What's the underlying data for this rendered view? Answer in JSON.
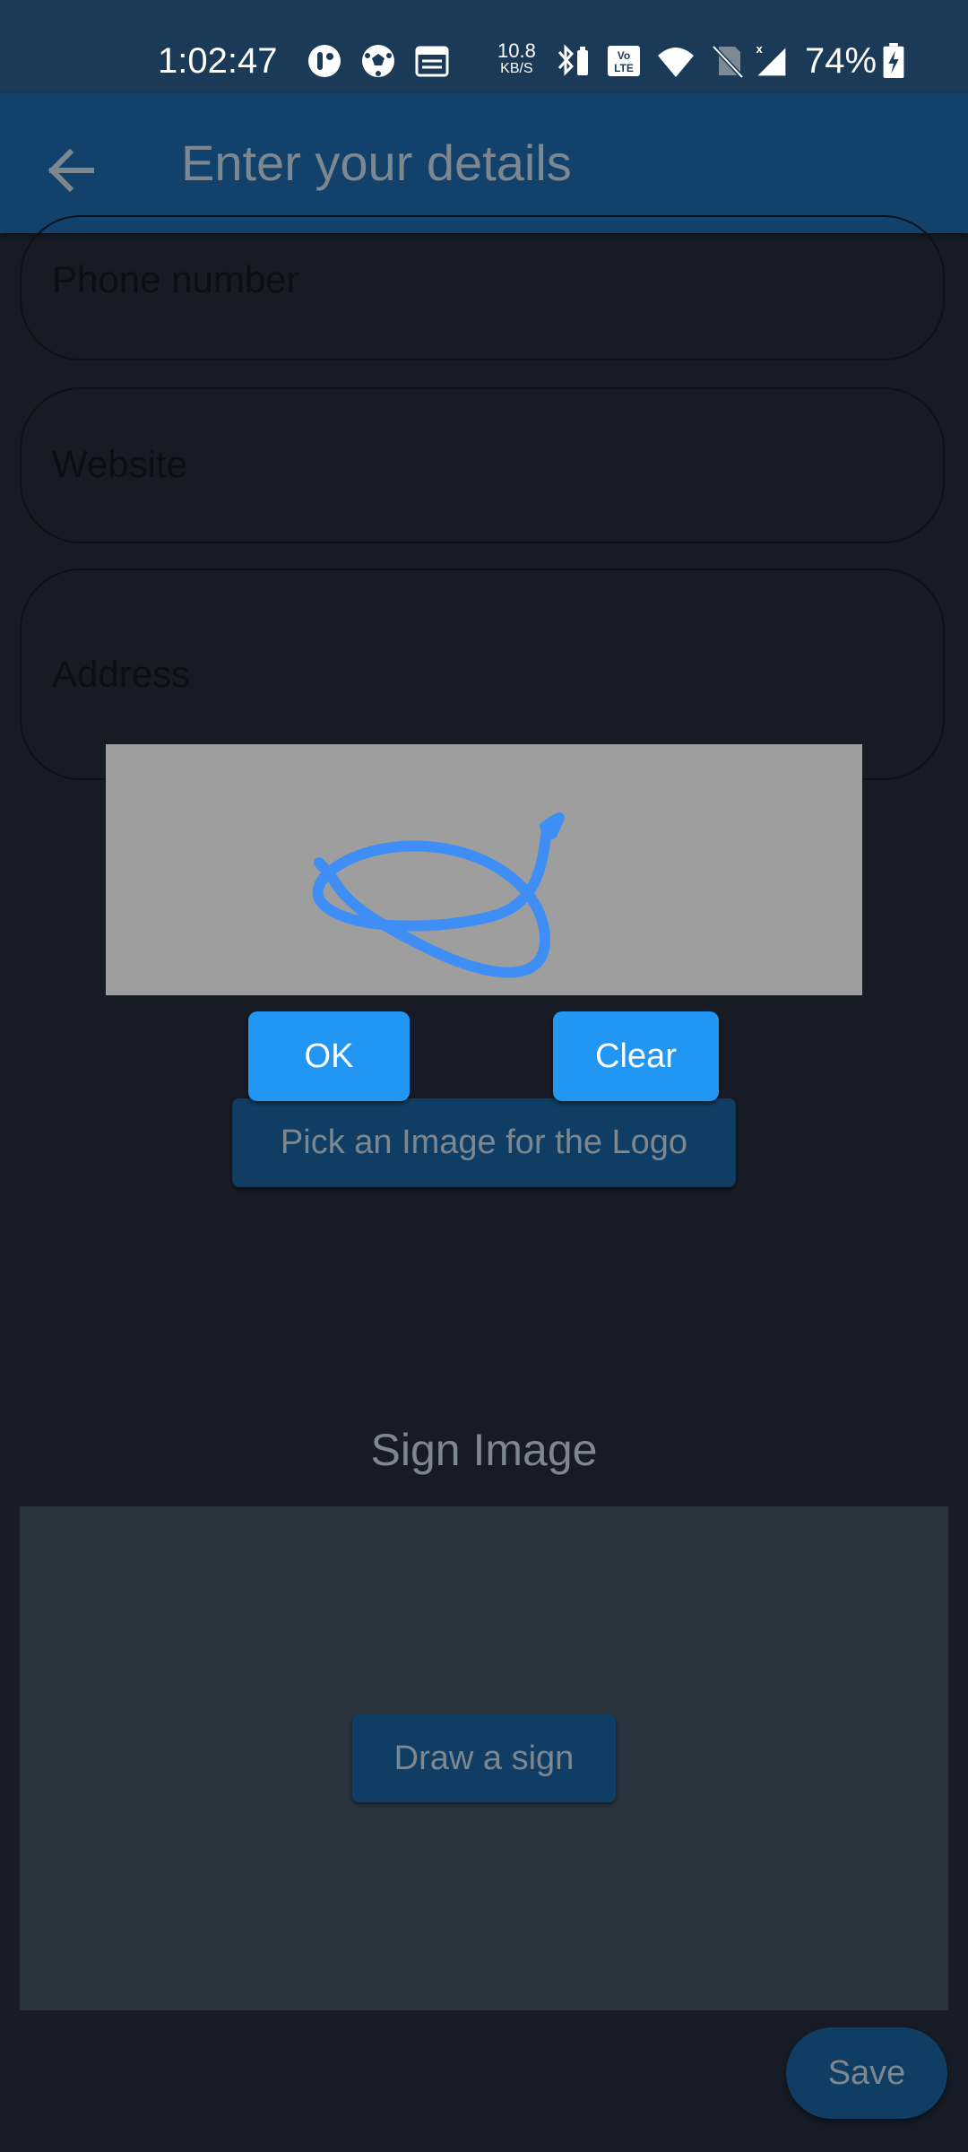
{
  "status_bar": {
    "time": "1:02:47",
    "net_speed_value": "10.8",
    "net_speed_unit": "KB/S",
    "battery_percent": "74%",
    "icons": [
      "app-notification-icon",
      "soccer-ball-icon",
      "calendar-icon",
      "bluetooth-battery-icon",
      "volte-icon",
      "wifi-icon",
      "no-sim-icon",
      "signal-icon",
      "battery-charging-icon"
    ]
  },
  "app_bar": {
    "title": "Enter your details",
    "back_icon": "arrow-left-icon"
  },
  "form": {
    "phone_label": "Phone number",
    "website_label": "Website",
    "address_label": "Address"
  },
  "dialog": {
    "ok_label": "OK",
    "clear_label": "Clear",
    "stroke_color": "#3f8ef5",
    "canvas_color": "#9e9e9e"
  },
  "logo": {
    "pick_label": "Pick an Image for the Logo"
  },
  "sign": {
    "title": "Sign Image",
    "draw_label": "Draw a sign"
  },
  "footer": {
    "save_label": "Save"
  },
  "colors": {
    "accent": "#2196f3",
    "appbar": "#12426c",
    "background": "#161b25"
  }
}
